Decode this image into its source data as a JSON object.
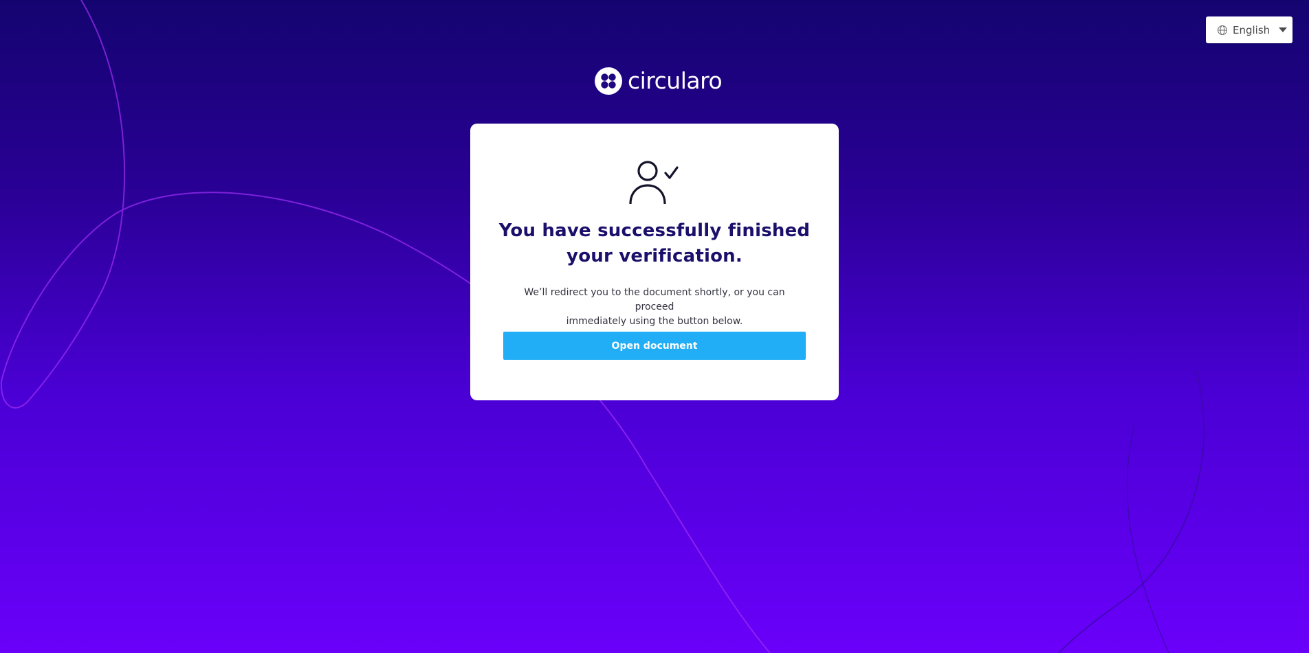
{
  "language": {
    "selected": "English",
    "icon": "globe-icon",
    "caret_icon": "caret-down-icon"
  },
  "brand": {
    "name": "circularo",
    "logo_icon": "circularo-logo-icon"
  },
  "verification": {
    "icon": "user-check-icon",
    "title_line1": "You have successfully finished",
    "title_line2": "your verification.",
    "message_line1": "We’ll redirect you to the document shortly, or you can proceed",
    "message_line2": "immediately using the button below.",
    "button_label": "Open document"
  },
  "colors": {
    "background_top": "#140470",
    "background_bottom": "#6a00fa",
    "title": "#1b0f6b",
    "button": "#22adf7",
    "card": "#ffffff"
  }
}
